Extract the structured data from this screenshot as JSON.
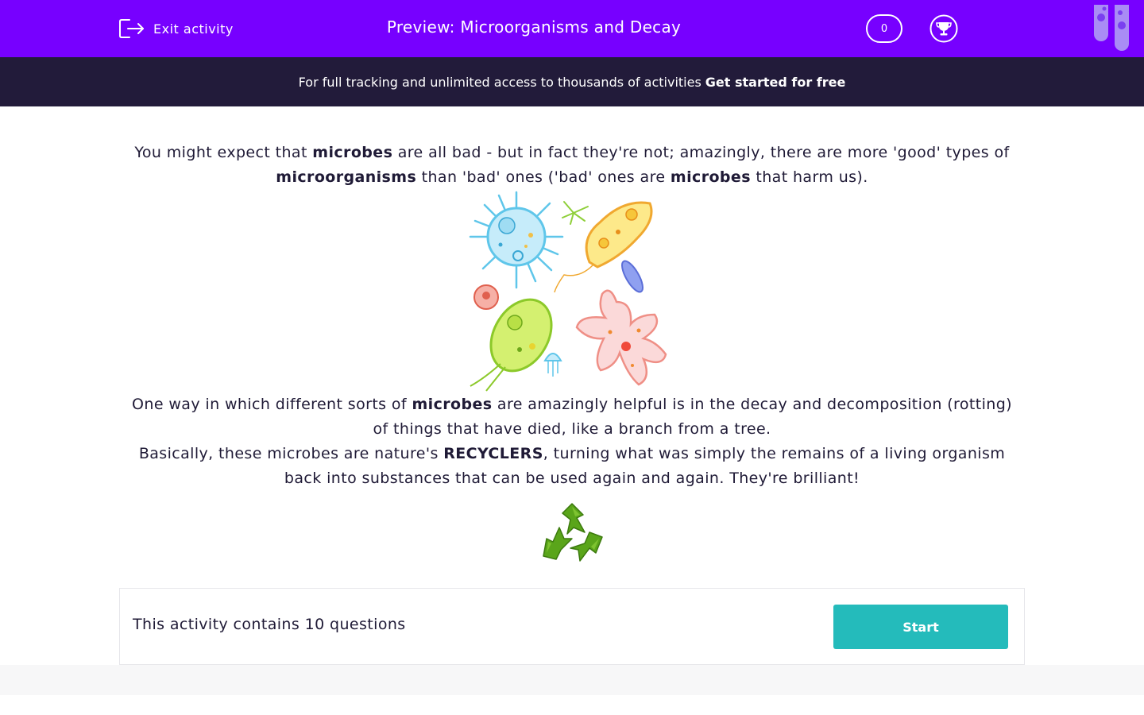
{
  "header": {
    "exit_label": "Exit activity",
    "title": "Preview: Microorganisms and Decay",
    "score": "0"
  },
  "banner": {
    "text": "For full tracking and unlimited access to thousands of activities",
    "cta": "Get started for free"
  },
  "content": {
    "p1": {
      "t1": "You might expect that ",
      "b1": "microbes",
      "t2": " are all bad - but in fact they're not; amazingly, there are more 'good' types of ",
      "b2": "microorganisms",
      "t3": " than 'bad' ones ('bad' ones are ",
      "b3": "microbes",
      "t4": " that harm us)."
    },
    "p2": {
      "t1": "One way in which different sorts of ",
      "b1": "microbes",
      "t2": " are amazingly helpful is in the decay and decomposition (rotting) of things that have died, like a branch from a tree."
    },
    "p3": {
      "t1": "Basically, these microbes are nature's ",
      "b1": "RECYCLERS",
      "t2": ", turning what was simply the remains of a living organism back into substances that can be used again and again. They're brilliant!"
    }
  },
  "activity": {
    "summary": "This activity contains 10 questions",
    "start_label": "Start"
  },
  "colors": {
    "brand_purple": "#7700ff",
    "banner_dark": "#221b3a",
    "start_teal": "#24bbbb"
  },
  "icons": [
    "exit-icon",
    "trophy-icon",
    "test-tubes-icon",
    "recycle-icon"
  ]
}
